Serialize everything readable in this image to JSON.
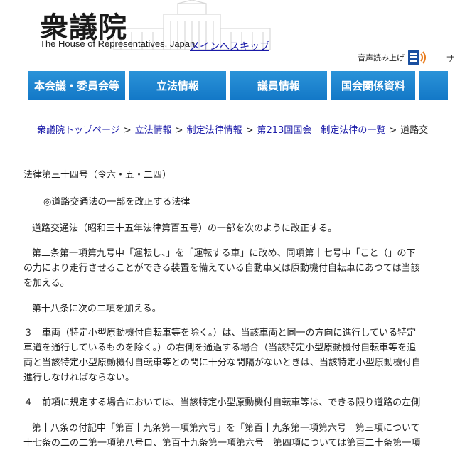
{
  "header": {
    "logo_kanji": "衆議院",
    "logo_en": "The House of Representatives, Japan",
    "skip_link": "メインへスキップ",
    "audio_label": "音声読み上げ",
    "truncated_item": "サ"
  },
  "nav": {
    "tabs": [
      "本会議・委員会等",
      "立法情報",
      "議員情報",
      "国会関係資料",
      ""
    ]
  },
  "breadcrumb": {
    "items": [
      "衆議院トップページ",
      "立法情報",
      "制定法律情報",
      "第213回国会　制定法律の一覧"
    ],
    "current": "道路交",
    "separator": ">"
  },
  "content": {
    "law_number": "法律第三十四号（令六・五・二四）",
    "law_title": "◎道路交通法の一部を改正する法律",
    "intro": "道路交通法（昭和三十五年法律第百五号）の一部を次のように改正する。",
    "art1_line1": "第二条第一項第九号中「運転し、」を「運転する車」に改め、同項第十七号中「こと（」の下",
    "art1_line2": "の力により走行させることができる装置を備えている自動車又は原動機付自転車にあつては当該",
    "art1_line3": "を加える。",
    "art2": "第十八条に次の二項を加える。",
    "art3_line1": "３　車両（特定小型原動機付自転車等を除く。）は、当該車両と同一の方向に進行している特定",
    "art3_line2": "車道を通行しているものを除く。）の右側を通過する場合（当該特定小型原動機付自転車等を追",
    "art3_line3": "両と当該特定小型原動機付自転車等との間に十分な間隔がないときは、当該特定小型原動機付自",
    "art3_line4": "進行しなければならない。",
    "art4": "４　前項に規定する場合においては、当該特定小型原動機付自転車等は、できる限り道路の左側",
    "art5_line1": "第十八条の付記中「第百十九条第一項第六号」を「第百十九条第一項第六号　第三項について",
    "art5_line2": "十七条の二の二第一項第八号ロ、第百十九条第一項第六号　第四項については第百二十条第一項"
  },
  "colors": {
    "nav_bg": "#1378c7",
    "link": "#1a1aa8",
    "audio_icon": "#1a4fa0",
    "audio_accent": "#e87a1a"
  }
}
